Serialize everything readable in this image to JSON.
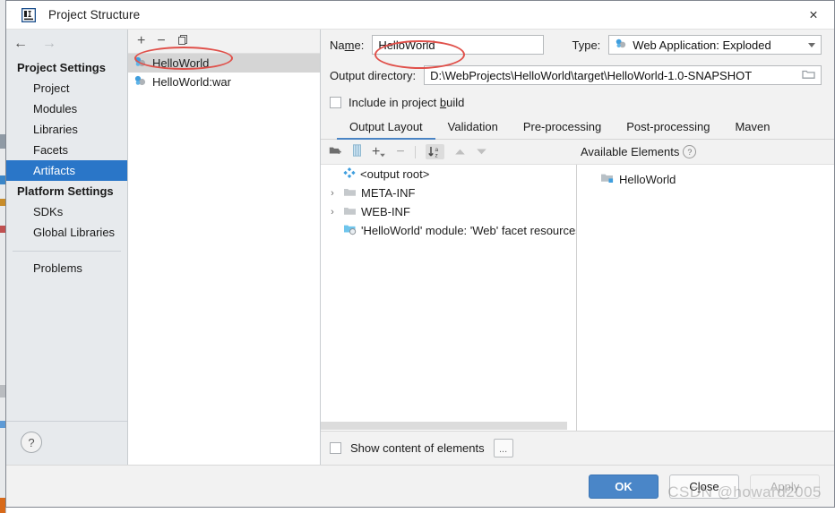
{
  "window": {
    "title": "Project Structure",
    "app_icon": "intellij-idea-icon",
    "close_icon": "✕"
  },
  "nav": {
    "back_icon": "←",
    "forward_icon": "→"
  },
  "sidebar": {
    "groups": [
      {
        "title": "Project Settings",
        "items": [
          {
            "label": "Project",
            "selected": false
          },
          {
            "label": "Modules",
            "selected": false
          },
          {
            "label": "Libraries",
            "selected": false
          },
          {
            "label": "Facets",
            "selected": false
          },
          {
            "label": "Artifacts",
            "selected": true
          }
        ]
      },
      {
        "title": "Platform Settings",
        "items": [
          {
            "label": "SDKs",
            "selected": false
          },
          {
            "label": "Global Libraries",
            "selected": false
          }
        ]
      }
    ],
    "problems": {
      "label": "Problems"
    },
    "help_label": "?"
  },
  "artifact_list": {
    "toolbar": [
      {
        "name": "add-artifact-button",
        "glyph": "+"
      },
      {
        "name": "remove-artifact-button",
        "glyph": "−"
      },
      {
        "name": "copy-artifact-button",
        "glyph": "❐"
      }
    ],
    "items": [
      {
        "label": "HelloWorld",
        "icon": "artifact-icon",
        "selected": true
      },
      {
        "label": "HelloWorld:war",
        "icon": "artifact-icon",
        "selected": false
      }
    ]
  },
  "detail": {
    "name_field": {
      "label": "Name:",
      "label_mnemonic": "m",
      "value": "HelloWorld"
    },
    "type_field": {
      "label": "Type:",
      "value": "Web Application: Exploded",
      "icon": "artifact-icon"
    },
    "output_dir_field": {
      "label": "Output directory:",
      "value": "D:\\WebProjects\\HelloWorld\\target\\HelloWorld-1.0-SNAPSHOT",
      "browse_icon": "folder-icon"
    },
    "include_in_build": {
      "label": "Include in project build",
      "label_mnemonic": "b",
      "checked": false
    },
    "tabs": [
      {
        "label": "Output Layout",
        "active": true
      },
      {
        "label": "Validation",
        "active": false
      },
      {
        "label": "Pre-processing",
        "active": false
      },
      {
        "label": "Post-processing",
        "active": false
      },
      {
        "label": "Maven",
        "active": false
      }
    ],
    "layout_toolbar": [
      {
        "name": "create-directory-button",
        "glyph": "▰"
      },
      {
        "name": "create-archive-button",
        "glyph": "▓"
      },
      {
        "name": "add-copy-button",
        "glyph": "+"
      },
      {
        "name": "remove-button",
        "glyph": "−"
      },
      {
        "name": "sort-alphabetically-button",
        "glyph": "↓az",
        "active": true
      },
      {
        "name": "move-up-button",
        "glyph": "▲"
      },
      {
        "name": "move-down-button",
        "glyph": "▼"
      }
    ],
    "available_elements": {
      "header": "Available Elements",
      "help_glyph": "?",
      "items": [
        {
          "label": "HelloWorld",
          "icon": "module-icon"
        }
      ]
    },
    "output_tree": [
      {
        "label": "<output root>",
        "icon": "artifact-root-icon",
        "indent": 0,
        "twisty": ""
      },
      {
        "label": "META-INF",
        "icon": "folder-icon",
        "indent": 0,
        "twisty": "›"
      },
      {
        "label": "WEB-INF",
        "icon": "folder-icon",
        "indent": 0,
        "twisty": "›"
      },
      {
        "label": "'HelloWorld' module: 'Web' facet resources",
        "icon": "facet-resource-icon",
        "indent": 1,
        "twisty": ""
      }
    ],
    "show_content": {
      "label": "Show content of elements",
      "checked": false,
      "more_label": "..."
    }
  },
  "footer": {
    "ok_label": "OK",
    "close_label": "Close",
    "close_mnemonic": "l",
    "apply_label": "Apply",
    "apply_disabled": true
  },
  "watermark": "CSDN @howard2005",
  "colors": {
    "accent_selection": "#2a76c8",
    "primary_button": "#4a86c8",
    "tab_underline": "#4a84c4",
    "annotation_red": "#e0504a",
    "dialog_bg": "#f2f2f2",
    "sidebar_bg": "#e7eaed"
  }
}
